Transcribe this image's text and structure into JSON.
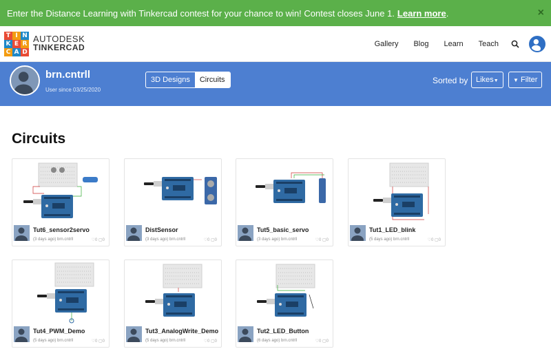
{
  "banner": {
    "text": "Enter the Distance Learning with Tinkercad contest for your chance to win! Contest closes June 1.",
    "link": "Learn more",
    "tail": ".",
    "close": "×"
  },
  "brand": {
    "logo_letters": [
      "T",
      "I",
      "N",
      "K",
      "E",
      "R",
      "C",
      "A",
      "D"
    ],
    "line1": "AUTODESK",
    "line2": "TINKERCAD"
  },
  "nav": {
    "items": [
      "Gallery",
      "Blog",
      "Learn",
      "Teach"
    ]
  },
  "profile": {
    "username": "brn.cntrll",
    "since": "User since 03/25/2020",
    "tabs": [
      "3D Designs",
      "Circuits"
    ],
    "active_tab": "Circuits",
    "sorted_label": "Sorted by",
    "sort_value": "Likes",
    "filter_label": "Filter"
  },
  "section_title": "Circuits",
  "cards": [
    {
      "title": "Tut6_sensor2servo",
      "meta": "(3 days ago) brn.cntrll",
      "likes": "0",
      "comments": "0"
    },
    {
      "title": "DistSensor",
      "meta": "(3 days ago) brn.cntrll",
      "likes": "0",
      "comments": "0"
    },
    {
      "title": "Tut5_basic_servo",
      "meta": "(3 days ago) brn.cntrll",
      "likes": "0",
      "comments": "0"
    },
    {
      "title": "Tut1_LED_blink",
      "meta": "(5 days ago) brn.cntrll",
      "likes": "0",
      "comments": "0"
    },
    {
      "title": "Tut4_PWM_Demo",
      "meta": "(5 days ago) brn.cntrll",
      "likes": "0",
      "comments": "0"
    },
    {
      "title": "Tut3_AnalogWrite_Demo",
      "meta": "(5 days ago) brn.cntrll",
      "likes": "0",
      "comments": "0"
    },
    {
      "title": "Tut2_LED_Button",
      "meta": "(6 days ago) brn.cntrll",
      "likes": "0",
      "comments": "0"
    }
  ],
  "colors": {
    "banner": "#5bb04a",
    "profile_bar": "#4d7fd1",
    "logo_red": "#e94b35",
    "logo_orange": "#f39c12",
    "logo_blue": "#1e88c8",
    "arduino": "#2f6aa3"
  }
}
